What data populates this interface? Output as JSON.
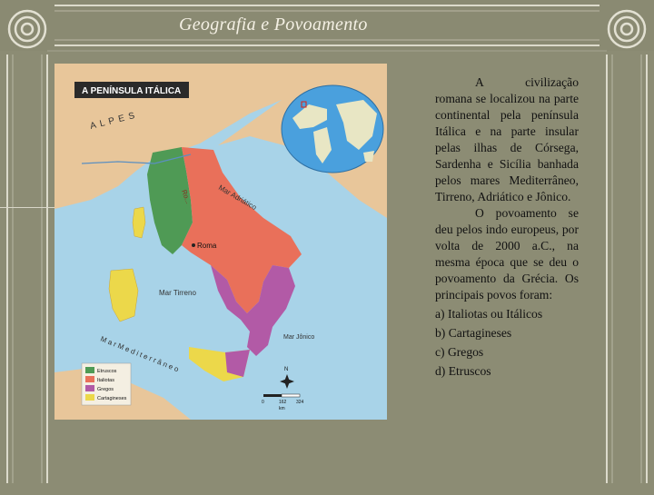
{
  "slide": {
    "title": "Geografia e Povoamento",
    "paragraphs": [
      "A civilização romana se localizou na parte continental pela península Itálica e na parte insular pelas ilhas de Córsega, Sardenha e Sicília banhada pelos mares Mediterrâneo, Tirreno, Adriático e Jônico.",
      "O povoamento se deu pelos indo europeus, por volta de 2000 a.C., na mesma época que se deu o povoamento da Grécia. Os principais povos foram:"
    ],
    "peoples_list": [
      "a) Italiotas ou Itálicos",
      "b) Cartagineses",
      "c) Gregos",
      "d) Etruscos"
    ]
  },
  "map": {
    "title": "A PENÍNSULA ITÁLICA",
    "labels": {
      "alpes": "A L P E S",
      "roma": "Roma",
      "mar_adriatico": "Mar Adriático",
      "mar_tirreno": "Mar Tirreno",
      "mar_jonico": "Mar Jônico",
      "mar_mediterraneo": "M a r   M e d i t e r r â n e o",
      "north": "N",
      "scale_0": "0",
      "scale_mid": "162",
      "scale_max": "324",
      "scale_unit": "km"
    },
    "legend": [
      {
        "label": "Etruscos",
        "color": "#4f9a55"
      },
      {
        "label": "Italiotas",
        "color": "#e9705a"
      },
      {
        "label": "Gregos",
        "color": "#b25aa6"
      },
      {
        "label": "Cartagineses",
        "color": "#ecd84a"
      }
    ],
    "colors": {
      "sea": "#a8d3e8",
      "land": "#e8c69a",
      "globe_ocean": "#4aa0dd",
      "globe_land": "#e8e6c4"
    }
  }
}
